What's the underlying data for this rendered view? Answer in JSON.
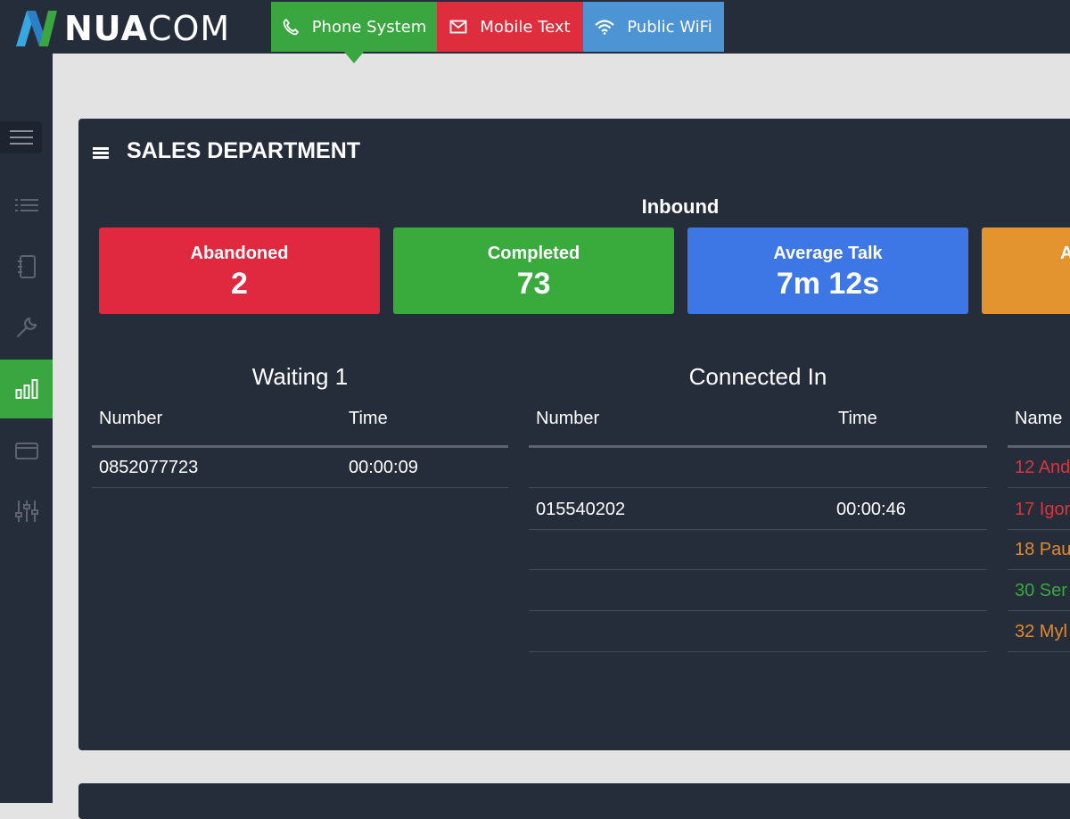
{
  "logo": {
    "text_bold": "NUA",
    "text_light": "COM"
  },
  "tabs": [
    {
      "label": "Phone System",
      "icon": "phone-icon",
      "color": "#3aa63f"
    },
    {
      "label": "Mobile Text",
      "icon": "envelope-icon",
      "color": "#de2e3d"
    },
    {
      "label": "Public WiFi",
      "icon": "wifi-icon",
      "color": "#4c94d3"
    }
  ],
  "sidebar": {
    "items": [
      {
        "icon": "hamburger-menu-icon"
      },
      {
        "icon": "list-icon"
      },
      {
        "icon": "notebook-icon"
      },
      {
        "icon": "wrench-icon"
      },
      {
        "icon": "bar-chart-icon",
        "active": true
      },
      {
        "icon": "wallet-icon"
      },
      {
        "icon": "sliders-icon"
      }
    ]
  },
  "panel": {
    "title": "SALES DEPARTMENT",
    "inbound_label": "Inbound",
    "stats": [
      {
        "label": "Abandoned",
        "value": "2",
        "color": "#e0293f"
      },
      {
        "label": "Completed",
        "value": "73",
        "color": "#39ab3d"
      },
      {
        "label": "Average Talk",
        "value": "7m 12s",
        "color": "#3d77e6"
      },
      {
        "label": "A",
        "value": "",
        "color": "#e4942f"
      }
    ],
    "waiting": {
      "title": "Waiting 1",
      "columns": [
        "Number",
        "Time"
      ],
      "rows": [
        {
          "number": "0852077723",
          "time": "00:00:09"
        }
      ]
    },
    "connected": {
      "title": "Connected In",
      "columns": [
        "Number",
        "Time"
      ],
      "rows": [
        {
          "number": "",
          "time": ""
        },
        {
          "number": "015540202",
          "time": "00:00:46"
        },
        {
          "number": "",
          "time": ""
        },
        {
          "number": "",
          "time": ""
        },
        {
          "number": "",
          "time": ""
        }
      ]
    },
    "agents": {
      "column": "Name",
      "rows": [
        {
          "name": "12 And",
          "color": "#d9343f"
        },
        {
          "name": "17 Igor",
          "color": "#d9343f"
        },
        {
          "name": "18 Pau",
          "color": "#e08a2c"
        },
        {
          "name": "30 Ser",
          "color": "#3aa63f"
        },
        {
          "name": "32 Myl",
          "color": "#e08a2c"
        }
      ]
    }
  }
}
